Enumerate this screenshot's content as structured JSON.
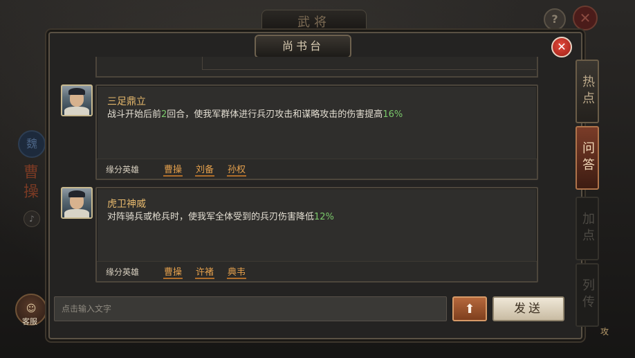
{
  "background": {
    "top_banner": "武将",
    "side_name": "曹操",
    "seal_text": "魏",
    "service_label": "客服",
    "attack_label": "攻"
  },
  "panel": {
    "title": "尚书台",
    "close_symbol": "✕"
  },
  "side_tabs": [
    {
      "label": "热点",
      "state": "normal"
    },
    {
      "label": "问答",
      "state": "active"
    },
    {
      "label": "加点",
      "state": "dim"
    },
    {
      "label": "列传",
      "state": "dim"
    }
  ],
  "items": [
    {
      "title": "三足鼎立",
      "body_before": "战斗开始后前",
      "body_num": "2",
      "body_middle": "回合，使我军群体进行兵刃攻击和谋略攻击的伤害提高",
      "body_pct": "16%",
      "fate_label": "缘分英雄",
      "fate_heroes": [
        "曹操",
        "刘备",
        "孙权"
      ]
    },
    {
      "title": "虎卫神威",
      "body_before": "对阵骑兵或枪兵时，使我军全体受到的兵刃伤害降低",
      "body_pct": "12%",
      "fate_label": "缘分英雄",
      "fate_heroes": [
        "曹操",
        "许褚",
        "典韦"
      ]
    }
  ],
  "input": {
    "placeholder": "点击输入文字",
    "up_symbol": "⬆",
    "send_label": "发送"
  },
  "colors": {
    "accent_orange": "#e4a04d",
    "highlight_green": "#7bc96b",
    "title_gold": "#e7b96d"
  }
}
